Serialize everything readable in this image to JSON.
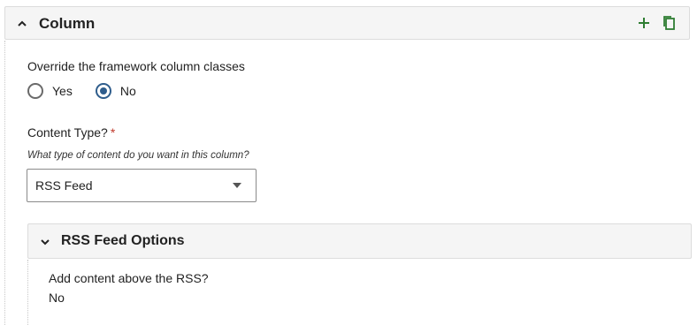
{
  "panel": {
    "title": "Column",
    "icons": {
      "collapse": "chevron-up-icon",
      "add": "plus-icon",
      "copy": "copy-icon"
    },
    "accent_color": "#2e7d32"
  },
  "override": {
    "label": "Override the framework column classes",
    "options": [
      {
        "label": "Yes",
        "checked": false
      },
      {
        "label": "No",
        "checked": true
      }
    ]
  },
  "content_type": {
    "label": "Content Type?",
    "required_marker": "*",
    "hint": "What type of content do you want in this column?",
    "selected": "RSS Feed"
  },
  "rss_options": {
    "title": "RSS Feed Options",
    "field_label": "Add content above the RSS?",
    "field_value": "No"
  }
}
